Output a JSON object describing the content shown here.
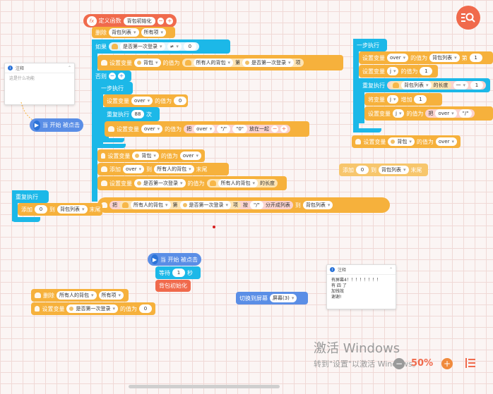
{
  "func": {
    "def_label": "定义函数",
    "name": "背包初始化"
  },
  "b_delete1": {
    "label": "删除",
    "list": "背包列表",
    "opt": "所有项"
  },
  "b_if": {
    "label": "如果",
    "var": "是否第一次登录",
    "op": "≠",
    "val": "0"
  },
  "b_set_bag": {
    "set": "设置变量",
    "var": "背包",
    "to": "的值为",
    "list": "所有人的背包",
    "nth": "第",
    "idx": "是否第一次登录",
    "item": "项"
  },
  "b_else": {
    "label": "否则"
  },
  "b_step1": {
    "label": "一步执行"
  },
  "b_set_over0": {
    "set": "设置变量",
    "var": "over",
    "to": "的值为",
    "val": "0"
  },
  "b_repeat88": {
    "label": "重复执行",
    "times": "88",
    "unit": "次"
  },
  "b_set_over_join": {
    "set": "设置变量",
    "var": "over",
    "to": "的值为",
    "join": "把",
    "a": "over",
    "b": "\"/\"",
    "c": "\"0\"",
    "tail": "放在一起"
  },
  "b_set_bag_over": {
    "set": "设置变量",
    "var": "背包",
    "to": "的值为",
    "val": "over"
  },
  "b_add_over": {
    "label": "添加",
    "val": "over",
    "to": "到",
    "list": "所有人的背包",
    "end": "末尾"
  },
  "b_set_first": {
    "set": "设置变量",
    "var": "是否第一次登录",
    "to": "的值为",
    "list": "所有人的背包",
    "len": "的长度"
  },
  "b_split": {
    "join": "把",
    "list": "所有人的背包",
    "nth": "第",
    "idx": "是否第一次登录",
    "item": "项",
    "by": "按",
    "sep": "\"/\"",
    "split": "分开成列表",
    "to": "到",
    "target": "背包列表"
  },
  "b_repeat_left": {
    "label": "重复执行"
  },
  "b_add_left": {
    "label": "添加",
    "val": "0",
    "to": "到",
    "list": "背包列表",
    "end": "末尾"
  },
  "note1": {
    "title": "注释",
    "body": "这是什么功能"
  },
  "start1": {
    "label": "当 开始 被点击"
  },
  "right": {
    "step": {
      "label": "一步执行"
    },
    "set_over": {
      "set": "设置变量",
      "var": "over",
      "to": "的值为",
      "list": "背包列表",
      "nth": "第",
      "val": "1"
    },
    "set_j": {
      "set": "设置变量",
      "var": "j",
      "to": "的值为",
      "val": "1"
    },
    "repeat": {
      "label": "重复执行",
      "list": "背包列表",
      "len": "的长度",
      "op": "一",
      "val": "1"
    },
    "change_j": {
      "set": "将变量",
      "var": "j",
      "inc": "增加",
      "val": "1"
    },
    "set_over2": {
      "set": "设置变量",
      "var": "j",
      "to": "的值为",
      "join": "把",
      "a": "over",
      "b": "\"/\""
    },
    "set_bag": {
      "set": "设置变量",
      "var": "背包",
      "to": "的值为",
      "val": "over"
    },
    "add": {
      "label": "添加",
      "val": "0",
      "to": "到",
      "list": "背包列表",
      "end": "末尾"
    }
  },
  "start2": {
    "label": "当 开始 被点击",
    "wait": "等待",
    "secs": "1",
    "unit": "秒",
    "call": "背包初始化"
  },
  "b_del2": {
    "label": "删除",
    "list": "所有人的背包",
    "opt": "所有项"
  },
  "b_set_first2": {
    "set": "设置变量",
    "var": "是否第一次登录",
    "to": "的值为",
    "val": "0"
  },
  "switch": {
    "label": "切换到屏幕",
    "screen": "屏幕(3)"
  },
  "note2": {
    "title": "注释",
    "body": "有屏幕4！！！！！！！！\n有 四 了\n加钱效\n谢谢!"
  },
  "zoom": {
    "value": "50%"
  },
  "watermark": {
    "line1": "激活 Windows",
    "line2": "转到\"设置\"以激活 Windows。"
  },
  "colors": {
    "orange": "#f6b13c",
    "cyan": "#1cb8e8",
    "blue": "#5a8ee6",
    "red": "#f06a4c"
  }
}
